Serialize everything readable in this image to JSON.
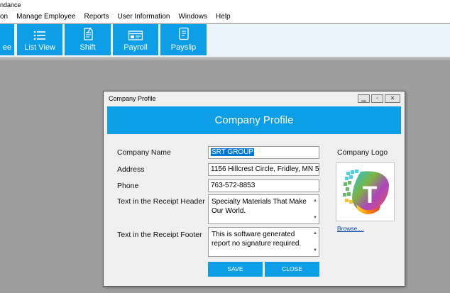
{
  "app": {
    "title": "ndance"
  },
  "menu": [
    "on",
    "Manage Employee",
    "Reports",
    "User Information",
    "Windows",
    "Help"
  ],
  "toolbar": {
    "buttons": [
      {
        "label": "ee",
        "icon": "employee-icon"
      },
      {
        "label": "List View",
        "icon": "list-icon"
      },
      {
        "label": "Shift",
        "icon": "document-icon"
      },
      {
        "label": "Payroll",
        "icon": "payroll-icon"
      },
      {
        "label": "Payslip",
        "icon": "payslip-icon"
      }
    ]
  },
  "dialog": {
    "window_title": "Company Profile",
    "banner_title": "Company Profile",
    "labels": {
      "company_name": "Company Name",
      "address": "Address",
      "phone": "Phone",
      "receipt_header": "Text in the Receipt Header",
      "receipt_footer": "Text in the Receipt Footer",
      "company_logo": "Company Logo"
    },
    "values": {
      "company_name": "SRT GROUP",
      "address": "1156 Hillcrest Circle, Fridley, MN 5",
      "phone": "763-572-8853",
      "receipt_header_line1": "Specialty Materials That Make",
      "receipt_header_line2": "Our World.",
      "receipt_footer_line1": "This is software generated",
      "receipt_footer_line2": "report no signature required."
    },
    "browse_label": "Browse....",
    "save_label": "SAVE",
    "close_label": "CLOSE",
    "logo_letter": "T"
  },
  "colors": {
    "accent": "#0e9ee8",
    "background": "#9e9e9e"
  }
}
